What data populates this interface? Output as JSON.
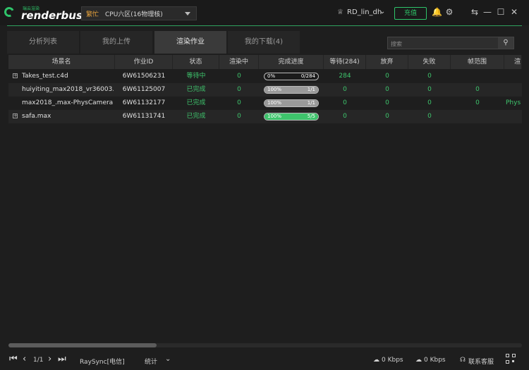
{
  "app": {
    "logo_small": "瑞云渲染",
    "logo_text": "renderbus"
  },
  "region": {
    "busy_label": "繁忙",
    "name": "CPU六区(16物理核)"
  },
  "user": {
    "name": "RD_lin_dh",
    "topup_label": "充值"
  },
  "tabs": [
    {
      "label": "分析列表"
    },
    {
      "label": "我的上传"
    },
    {
      "label": "渲染作业"
    },
    {
      "label": "我的下载(4)"
    }
  ],
  "search": {
    "placeholder": "搜索"
  },
  "table": {
    "headers": [
      "场景名",
      "作业ID",
      "状态",
      "渲染中",
      "完成进度",
      "等待(284)",
      "放弃",
      "失败",
      "帧范围",
      "渲"
    ],
    "rows": [
      {
        "name": "Takes_test.c4d",
        "id": "6W61506231",
        "status": "等待中",
        "rendering": "0",
        "progress_pct": 0,
        "progress_left": "0%",
        "progress_right": "0/284",
        "waiting": "284",
        "abandon": "0",
        "failed": "0",
        "frame_range": "",
        "extra": "",
        "expand": true
      },
      {
        "name": "huiyiting_max2018_vr36003....",
        "id": "6W61125007",
        "status": "已完成",
        "rendering": "0",
        "progress_pct": 100,
        "progress_left": "100%",
        "progress_right": "1/1",
        "waiting": "0",
        "abandon": "0",
        "failed": "0",
        "frame_range": "0",
        "extra": "",
        "expand": false
      },
      {
        "name": "max2018_.max-PhysCamera....",
        "id": "6W61132177",
        "status": "已完成",
        "rendering": "0",
        "progress_pct": 100,
        "progress_left": "100%",
        "progress_right": "1/1",
        "waiting": "0",
        "abandon": "0",
        "failed": "0",
        "frame_range": "0",
        "extra": "Phys",
        "expand": false
      },
      {
        "name": "safa.max",
        "id": "6W61131741",
        "status": "已完成",
        "rendering": "0",
        "progress_pct": 100,
        "progress_left": "100%",
        "progress_right": "5/5",
        "waiting": "0",
        "abandon": "0",
        "failed": "0",
        "frame_range": "",
        "extra": "",
        "expand": true
      }
    ]
  },
  "footer": {
    "page": "1/1",
    "raysync": "RaySync[电信]",
    "stats": "统计",
    "upload_speed": "0 Kbps",
    "download_speed": "0 Kbps",
    "support": "联系客服"
  },
  "colors": {
    "accent": "#2fc46a",
    "progress_full": "#3ec46c",
    "progress_partial": "#9a9a9a",
    "busy": "#e8a33c"
  }
}
